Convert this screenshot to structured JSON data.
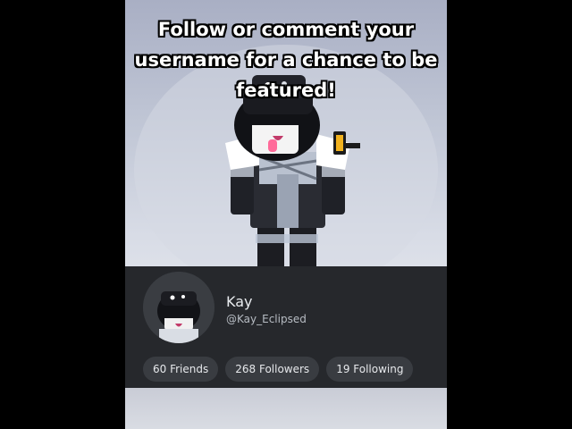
{
  "caption": {
    "line1": "Follow or comment your",
    "line2": "username for a chance to be",
    "line3": "featured!"
  },
  "profile": {
    "display_name": "Kay",
    "username": "@Kay_Eclipsed",
    "stats": [
      {
        "label": "60 Friends"
      },
      {
        "label": "268 Followers"
      },
      {
        "label": "19 Following"
      }
    ]
  },
  "icons": [
    "avatar-character",
    "profile-avatar-icon"
  ],
  "colors": {
    "background": "#000000",
    "card": "#26282c",
    "pill": "#393c41",
    "caption_text": "#ffffff"
  }
}
